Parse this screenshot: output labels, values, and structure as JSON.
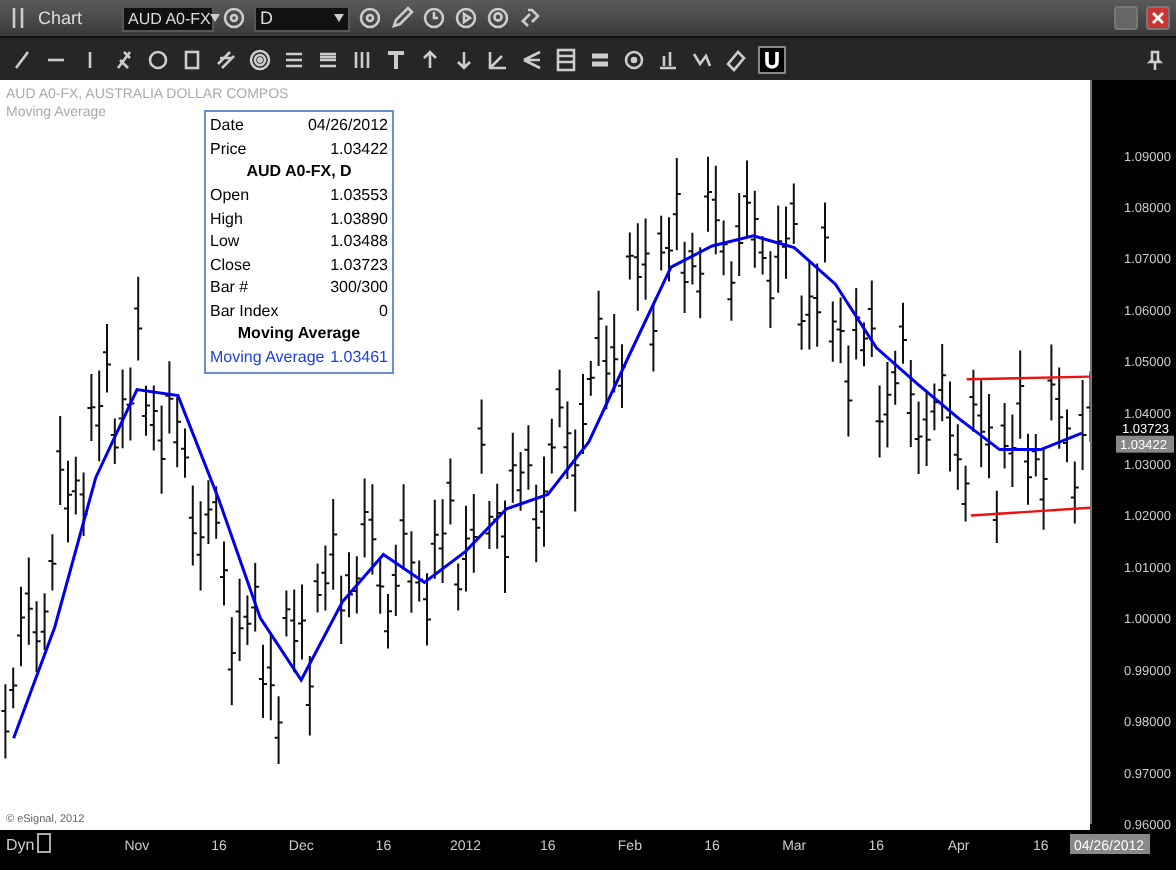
{
  "window": {
    "title": "Chart"
  },
  "toolbar": {
    "symbol": "AUD A0-FX",
    "interval": "D"
  },
  "chart": {
    "header": "AUD A0-FX, AUSTRALIA DOLLAR COMPOS",
    "copyright": "© eSignal, 2012",
    "axis_mode": "Dyn",
    "current_date": "04/26/2012",
    "price_markers": [
      {
        "kind": "close",
        "label": "1.03723"
      },
      {
        "kind": "cursor",
        "label": "1.03422"
      }
    ],
    "chart_data": {
      "type": "line",
      "ylim": [
        0.96,
        1.1047
      ],
      "categories": [
        null,
        null,
        null,
        "Nov",
        null,
        "16",
        null,
        "Dec",
        null,
        "16",
        null,
        "2012",
        null,
        "16",
        null,
        "Feb",
        null,
        "16",
        null,
        "Mar",
        null,
        "16",
        null,
        "Apr",
        null,
        "16",
        null
      ],
      "yticks": [
        {
          "value": 1.09,
          "label": "1.09000"
        },
        {
          "value": 1.08,
          "label": "1.08000"
        },
        {
          "value": 1.07,
          "label": "1.07000"
        },
        {
          "value": 1.06,
          "label": "1.06000"
        },
        {
          "value": 1.05,
          "label": "1.05000"
        },
        {
          "value": 1.04,
          "label": "1.04000"
        },
        {
          "value": 1.03,
          "label": "1.03000"
        },
        {
          "value": 1.02,
          "label": "1.02000"
        },
        {
          "value": 1.01,
          "label": "1.01000"
        },
        {
          "value": 1.0,
          "label": "1.00000"
        },
        {
          "value": 0.99,
          "label": "0.99000"
        },
        {
          "value": 0.98,
          "label": "0.98000"
        },
        {
          "value": 0.97,
          "label": "0.97000"
        },
        {
          "value": 0.96,
          "label": "0.96000"
        }
      ],
      "series": [
        {
          "name": "Moving Average",
          "color": "#0000ee",
          "values": [
            0.9767,
            0.9983,
            1.0274,
            1.0445,
            1.0433,
            1.023,
            1.0001,
            0.988,
            1.0032,
            1.0124,
            1.007,
            1.013,
            1.0213,
            1.0241,
            1.0343,
            1.0514,
            1.0683,
            1.0724,
            1.0744,
            1.0721,
            1.065,
            1.0526,
            1.0456,
            1.0389,
            1.0328,
            1.0328,
            1.036
          ]
        }
      ]
    }
  },
  "data_window": {
    "rows": [
      {
        "kind": "pair",
        "label": "Date",
        "value": "04/26/2012"
      },
      {
        "kind": "pair",
        "label": "Price",
        "value": "1.03422"
      },
      {
        "kind": "heading",
        "label": "AUD A0-FX, D"
      },
      {
        "kind": "pair",
        "label": "Open",
        "value": "1.03553"
      },
      {
        "kind": "pair",
        "label": "High",
        "value": "1.03890"
      },
      {
        "kind": "pair",
        "label": "Low",
        "value": "1.03488"
      },
      {
        "kind": "pair",
        "label": "Close",
        "value": "1.03723"
      },
      {
        "kind": "pair",
        "label": "Bar #",
        "value": "300/300"
      },
      {
        "kind": "pair",
        "label": "Bar Index",
        "value": "0"
      },
      {
        "kind": "heading",
        "label": "Moving Average"
      },
      {
        "kind": "study",
        "label": "Moving Average",
        "value": "1.03461"
      }
    ]
  }
}
